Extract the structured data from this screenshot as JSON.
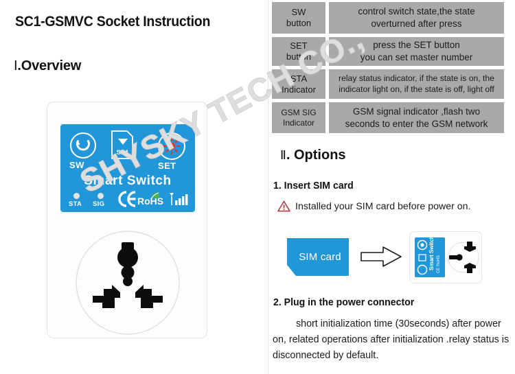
{
  "watermark": {
    "text": "SHYSKY TECH CO.,"
  },
  "document": {
    "title": "SC1-GSMVC  Socket Instruction",
    "sections": {
      "overview": {
        "numeral": "Ⅰ",
        "separator": ".",
        "label": "Overview"
      },
      "options": {
        "numeral": "Ⅱ",
        "separator": ".",
        "label": "Options"
      }
    }
  },
  "device": {
    "brand": "Smart Switch",
    "buttons": [
      {
        "name": "sw-button",
        "label": "SW",
        "icon": "refresh-arrow-icon"
      },
      {
        "name": "set-button",
        "label": "SET",
        "icon": "sun-burst-icon"
      }
    ],
    "sim_slot": {
      "label": "SIM",
      "icon": "sim-slot-icon"
    },
    "leds": [
      {
        "name": "sta-led",
        "label": "STA"
      },
      {
        "name": "sig-led",
        "label": "SIG"
      }
    ],
    "certifications": [
      "CE",
      "RoHS",
      "signal-bars"
    ],
    "panel_color": "#2196d9",
    "socket_type": "universal-socket"
  },
  "spec_table": {
    "rows": [
      {
        "key": "SW\nbutton",
        "key_lines": [
          "SW",
          "button"
        ],
        "value_lines": [
          "control switch state,the state",
          "overturned after press"
        ]
      },
      {
        "key": "SET\nbutton",
        "key_lines": [
          "SET",
          "button"
        ],
        "value_lines": [
          "press the SET button",
          "you can set master number"
        ]
      },
      {
        "key": "STA\nIndicator",
        "key_lines": [
          "STA",
          "Indicator"
        ],
        "value_lines": [
          "relay status indicator, if the state is on, the",
          "indicator light on, if the state is off, light off"
        ]
      },
      {
        "key": "GSM SIG\nIndicator",
        "key_lines": [
          "GSM SIG",
          "Indicator"
        ],
        "value_lines": [
          "GSM signal indicator ,flash two",
          "seconds to enter the GSM network"
        ]
      }
    ],
    "cell_color": "#a9a9a9"
  },
  "steps": [
    {
      "number": "1.",
      "heading": "1. Insert SIM card",
      "warning": {
        "icon": "warning-triangle-icon",
        "color": "#b03a3a",
        "text": "Installed your SIM card before power on."
      },
      "diagram": {
        "sim_card_label": "SIM card",
        "arrow": "right-arrow-icon",
        "sim_card_color": "#2196d9"
      }
    },
    {
      "number": "2.",
      "heading": "2. Plug in the power connector",
      "body": "short initialization time (30seconds) after power on, related operations after initialization .relay status is disconnected by default."
    }
  ]
}
